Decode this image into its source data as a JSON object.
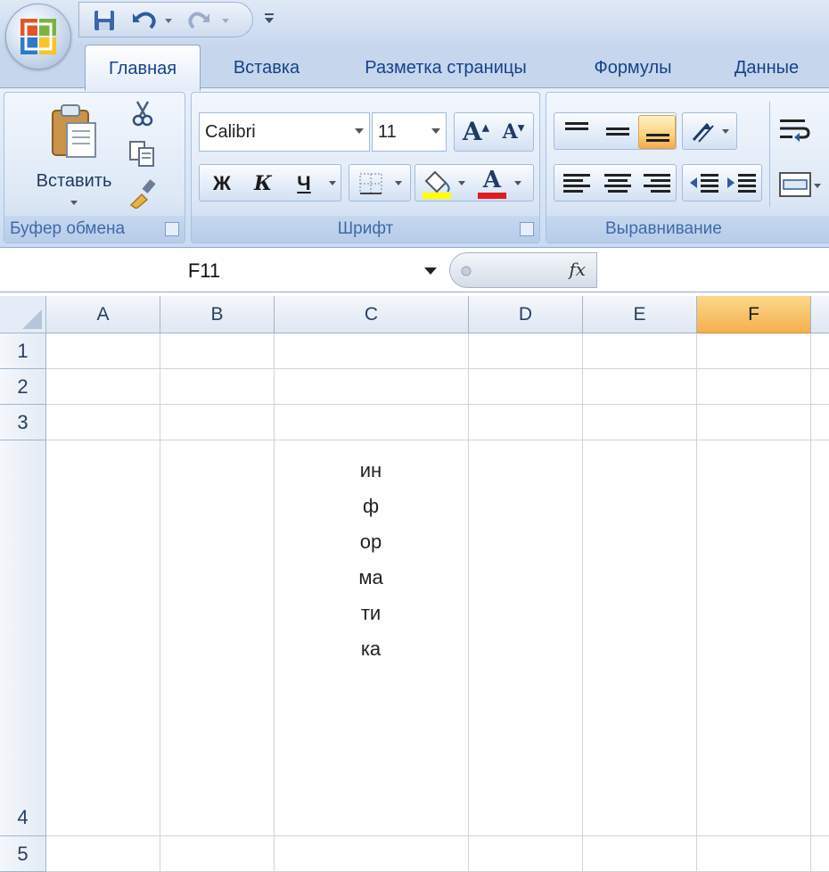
{
  "ribbon_tabs": [
    {
      "label": "Главная",
      "active": true
    },
    {
      "label": "Вставка",
      "active": false
    },
    {
      "label": "Разметка страницы",
      "active": false
    },
    {
      "label": "Формулы",
      "active": false
    },
    {
      "label": "Данные",
      "active": false
    }
  ],
  "clipboard": {
    "paste_label": "Вставить",
    "group_label": "Буфер обмена"
  },
  "font": {
    "name": "Calibri",
    "size": "11",
    "bold_label": "Ж",
    "italic_label": "К",
    "underline_label": "Ч",
    "grow_label": "A",
    "shrink_label": "A",
    "color_label": "A",
    "group_label": "Шрифт"
  },
  "alignment": {
    "group_label": "Выравнивание"
  },
  "formula_bar": {
    "name_box": "F11",
    "fx_label": "fx",
    "formula": ""
  },
  "sheet": {
    "columns": [
      "A",
      "B",
      "C",
      "D",
      "E",
      "F"
    ],
    "selected_column": "F",
    "rows": [
      "1",
      "2",
      "3",
      "4",
      "5"
    ],
    "cell_c4": "информатика"
  },
  "colors": {
    "accent": "#f4b04f",
    "tab_text": "#15428b",
    "ribbon": "#dce8f6"
  },
  "icons": [
    "office-logo",
    "save-icon",
    "undo-icon",
    "redo-icon",
    "customize-icon",
    "paste-icon",
    "cut-icon",
    "copy-icon",
    "format-painter-icon",
    "borders-icon",
    "fill-color-icon",
    "align-top-icon",
    "align-middle-icon",
    "align-bottom-icon",
    "text-orientation-icon",
    "align-left-icon",
    "align-center-icon",
    "align-right-icon",
    "decrease-indent-icon",
    "increase-indent-icon",
    "wrap-text-icon",
    "merge-center-icon",
    "select-all-icon"
  ]
}
